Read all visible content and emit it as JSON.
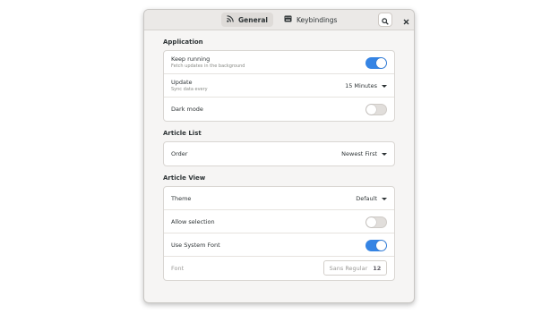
{
  "header": {
    "tabs": [
      {
        "label": "General",
        "icon": "rss-icon",
        "active": true
      },
      {
        "label": "Keybindings",
        "icon": "keyboard-icon",
        "active": false
      }
    ],
    "search_icon": "search-icon",
    "close_icon": "close-icon"
  },
  "application": {
    "title": "Application",
    "keep_running": {
      "label": "Keep running",
      "subtitle": "Fetch updates in the background",
      "on": true
    },
    "update": {
      "label": "Update",
      "subtitle": "Sync data every",
      "value": "15 Minutes"
    },
    "dark_mode": {
      "label": "Dark mode",
      "on": false
    }
  },
  "article_list": {
    "title": "Article List",
    "order": {
      "label": "Order",
      "value": "Newest First"
    }
  },
  "article_view": {
    "title": "Article View",
    "theme": {
      "label": "Theme",
      "value": "Default"
    },
    "allow_selection": {
      "label": "Allow selection",
      "on": false
    },
    "system_font": {
      "label": "Use System Font",
      "on": true
    },
    "font": {
      "label": "Font",
      "name": "Sans Regular",
      "size": "12"
    }
  },
  "colors": {
    "accent": "#3584e4",
    "window_bg": "#f6f5f4",
    "card_bg": "#ffffff"
  }
}
